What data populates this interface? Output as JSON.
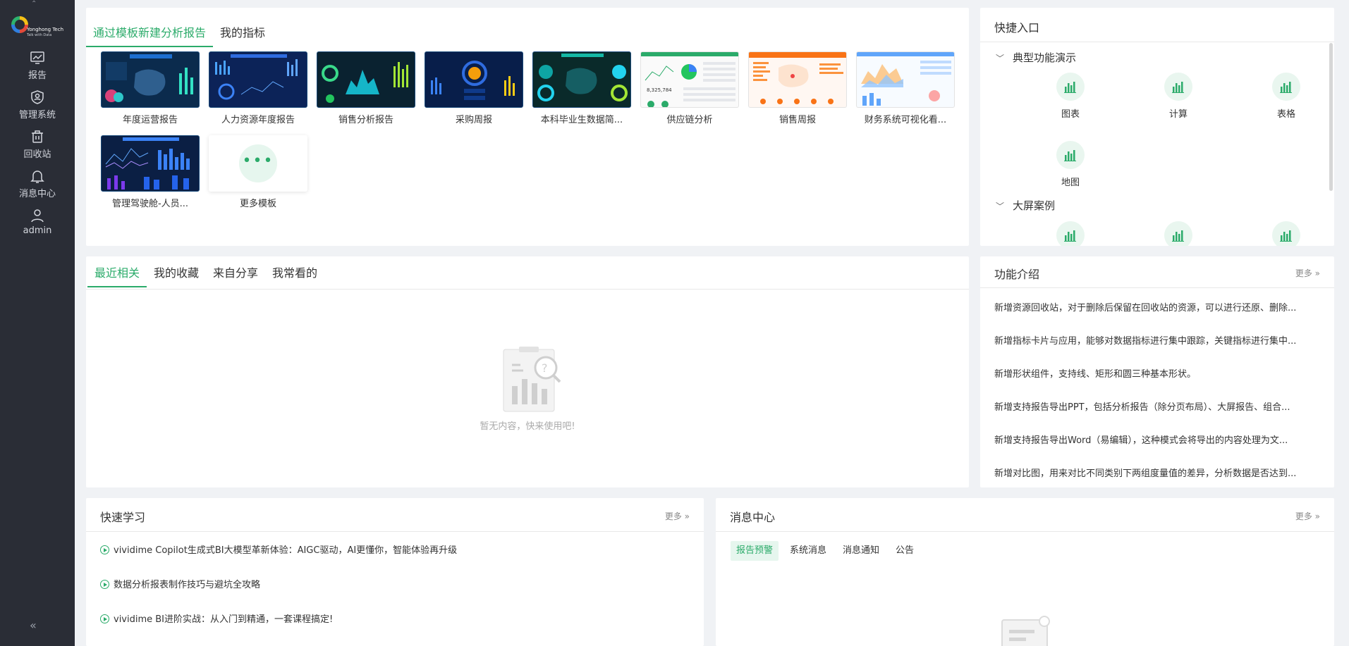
{
  "sidebar": {
    "brand": "Yonghong Tech",
    "brand_sub": "Talk with Data",
    "items": [
      {
        "label": "报告",
        "icon": "chart-screen-icon"
      },
      {
        "label": "管理系统",
        "icon": "shield-user-icon"
      },
      {
        "label": "回收站",
        "icon": "trash-icon"
      },
      {
        "label": "消息中心",
        "icon": "bell-icon"
      },
      {
        "label": "admin",
        "icon": "user-icon"
      }
    ],
    "collapse": "«"
  },
  "templates_card": {
    "tabs": [
      "通过模板新建分析报告",
      "我的指标"
    ],
    "templates": [
      {
        "label": "年度运营报告",
        "theme": "dark"
      },
      {
        "label": "人力资源年度报告",
        "theme": "dark"
      },
      {
        "label": "销售分析报告",
        "theme": "dark"
      },
      {
        "label": "采购周报",
        "theme": "dark"
      },
      {
        "label": "本科毕业生数据简...",
        "theme": "dark"
      },
      {
        "label": "供应链分析",
        "theme": "light"
      },
      {
        "label": "销售周报",
        "theme": "light"
      },
      {
        "label": "财务系统可视化看...",
        "theme": "light"
      },
      {
        "label": "管理驾驶舱-人员...",
        "theme": "dark"
      }
    ],
    "more_label": "更多模板",
    "more_dots": "•••"
  },
  "quick_entry": {
    "title": "快捷入口",
    "groups": [
      {
        "title": "典型功能演示",
        "items": [
          "图表",
          "计算",
          "表格",
          "地图"
        ]
      },
      {
        "title": "大屏案例",
        "items": [
          "",
          "",
          ""
        ]
      }
    ]
  },
  "recent_card": {
    "tabs": [
      "最近相关",
      "我的收藏",
      "来自分享",
      "我常看的"
    ],
    "empty_text": "暂无内容，快来使用吧!"
  },
  "feature_intro": {
    "title": "功能介绍",
    "more": "更多",
    "items": [
      "新增资源回收站，对于删除后保留在回收站的资源，可以进行还原、删除...",
      "新增指标卡片与应用，能够对数据指标进行集中跟踪，关键指标进行集中...",
      "新增形状组件，支持线、矩形和圆三种基本形状。",
      "新增支持报告导出PPT，包括分析报告（除分页布局）、大屏报告、组合...",
      "新增支持报告导出Word（易编辑），这种模式会将导出的内容处理为文...",
      "新增对比图，用来对比不同类别下两组度量值的差异，分析数据是否达到..."
    ]
  },
  "quick_learn": {
    "title": "快速学习",
    "more": "更多",
    "items": [
      "vividime Copilot生成式BI大模型革新体验：AIGC驱动，AI更懂你，智能体验再升级",
      "数据分析报表制作技巧与避坑全攻略",
      "vividime BI进阶实战：从入门到精通，一套课程搞定!"
    ]
  },
  "message_center": {
    "title": "消息中心",
    "more": "更多",
    "tabs": [
      "报告预警",
      "系统消息",
      "消息通知",
      "公告"
    ]
  },
  "colors": {
    "accent": "#2bab6a",
    "sidebar": "#2a2d36",
    "background": "#f0f2f5"
  }
}
